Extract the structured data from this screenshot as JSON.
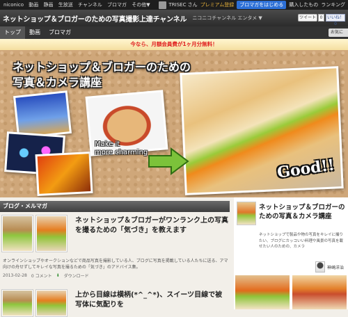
{
  "topbar": {
    "nav": [
      "niconico",
      "動画",
      "静画",
      "生放送",
      "チャンネル",
      "ブロマガ",
      "その他▼"
    ],
    "user": "TRISEC さん",
    "premium": "プレミアム登録",
    "start_blomaga": "ブロマガをはじめる",
    "purchase": "購入したもの",
    "ranking": "ランキング"
  },
  "channel": {
    "title": "ネットショップ＆ブロガーのための写真撮影上達チャンネル",
    "sub": "ニコニコチャンネル エンタメ ▼",
    "tweet": "ツイート",
    "tweet_count": "0",
    "fb_like": "いいね！ 0"
  },
  "tabs": [
    "トップ",
    "動画",
    "ブロマガ"
  ],
  "fav_button": "お気に",
  "promo": "今なら、月額会員費が1ヶ月分無料！",
  "banner": {
    "title_line1": "ネットショップ＆ブロガーのための",
    "title_line2": "写真＆カメラ講座",
    "make": "Make it",
    "charming": "more charming",
    "good": "Good!!"
  },
  "section": {
    "title": "ブログ・メルマガ"
  },
  "post1": {
    "title": "ネットショップ＆ブロガーがワンランク上の写真を撮るための「気づき」を教えます",
    "desc": "オンラインショップやオークションなどで商品写真を撮影している人、ブログに写真を掲載している人たちに送る、アマ向けの舟せずしてキレイな写真を撮るための「気づき」のアドバイス集。",
    "date": "2013-02-28",
    "comments": "0 コメント",
    "download": "ダウンロード"
  },
  "post2": {
    "title": "上から目線は横柄(*^_^*)、スイーツ目線で被写体に気配りを"
  },
  "sidebar": {
    "title": "ネットショップ＆ブロガーのための写真＆カメラ講座",
    "desc": "ネットショップで製品や物の写真をキレイに撮りたい、ブログにカッコいい料理や風景の写真を載せたい人のための、カメラ",
    "author": "神崎洋治"
  }
}
